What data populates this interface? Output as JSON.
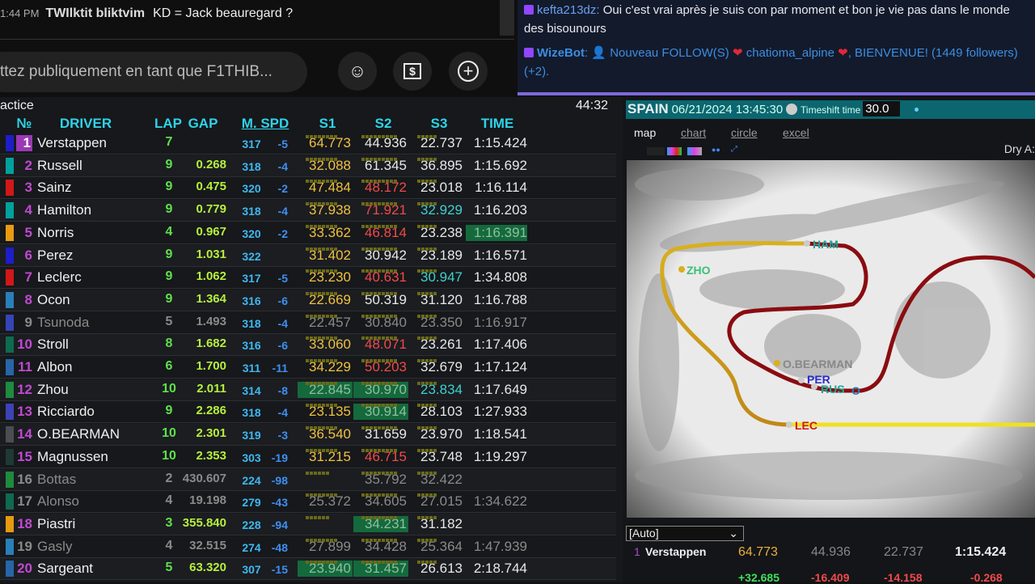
{
  "yt_chat": {
    "time": "1:44 PM",
    "author": "TWIlktit bliktvim",
    "message": "KD = Jack beauregard ?",
    "input_placeholder": "ttez publiquement en tant que F1THIB...",
    "emoji_icon": "emoji-icon",
    "super_chat_icon": "dollar-icon",
    "add_icon": "plus-icon"
  },
  "twitch_chat": [
    {
      "user": "kefta213dz",
      "message": "Oui c'est vrai après je suis con par moment et bon je vie pas dans le monde des bisounours"
    },
    {
      "user": "WizeBot",
      "message_pre": "👤 Nouveau FOLLOW(S) ",
      "heart": "❤",
      "follower": "chatioma_alpine",
      "message_post": ", BIENVENUE! (1449 followers) (+2)."
    }
  ],
  "timing": {
    "session": "actice",
    "clock": "44:32",
    "headers": {
      "no": "№",
      "driver": "DRIVER",
      "lap": "LAP",
      "gap": "GAP",
      "mspd": "M. SPD",
      "s1": "S1",
      "s2": "S2",
      "s3": "S3",
      "time": "TIME"
    },
    "rows": [
      {
        "pos": "1",
        "name": "Verstappen",
        "team": "#1e1ec8",
        "lap": "7",
        "gap": "",
        "spd": "317",
        "dspd": "-5",
        "s1": [
          "64.773",
          "y"
        ],
        "s2": [
          "44.936",
          "w"
        ],
        "s3": [
          "22.737",
          "w"
        ],
        "time": [
          "1:15.424",
          "w"
        ]
      },
      {
        "pos": "2",
        "name": "Russell",
        "team": "#00a19c",
        "lap": "9",
        "gap": "0.268",
        "spd": "318",
        "dspd": "-4",
        "s1": [
          "32.088",
          "y"
        ],
        "s2": [
          "61.345",
          "w"
        ],
        "s3": [
          "36.895",
          "w"
        ],
        "time": [
          "1:15.692",
          "w"
        ]
      },
      {
        "pos": "3",
        "name": "Sainz",
        "team": "#d01818",
        "lap": "9",
        "gap": "0.475",
        "spd": "320",
        "dspd": "-2",
        "s1": [
          "47.484",
          "y"
        ],
        "s2": [
          "48.172",
          "r"
        ],
        "s3": [
          "23.018",
          "w"
        ],
        "time": [
          "1:16.114",
          "w"
        ]
      },
      {
        "pos": "4",
        "name": "Hamilton",
        "team": "#00a19c",
        "lap": "9",
        "gap": "0.779",
        "spd": "318",
        "dspd": "-4",
        "s1": [
          "37.938",
          "y"
        ],
        "s2": [
          "71.921",
          "r"
        ],
        "s3": [
          "32.929",
          "c"
        ],
        "time": [
          "1:16.203",
          "w"
        ]
      },
      {
        "pos": "5",
        "name": "Norris",
        "team": "#e89a10",
        "lap": "4",
        "gap": "0.967",
        "spd": "320",
        "dspd": "-2",
        "s1": [
          "33.362",
          "y"
        ],
        "s2": [
          "46.814",
          "r"
        ],
        "s3": [
          "23.238",
          "w"
        ],
        "time": [
          "1:16.391",
          "tg"
        ]
      },
      {
        "pos": "6",
        "name": "Perez",
        "team": "#1e1ec8",
        "lap": "9",
        "gap": "1.031",
        "spd": "322",
        "dspd": "",
        "s1": [
          "31.402",
          "y"
        ],
        "s2": [
          "30.942",
          "w"
        ],
        "s3": [
          "23.189",
          "w"
        ],
        "time": [
          "1:16.571",
          "w"
        ]
      },
      {
        "pos": "7",
        "name": "Leclerc",
        "team": "#d01818",
        "lap": "9",
        "gap": "1.062",
        "spd": "317",
        "dspd": "-5",
        "s1": [
          "23.230",
          "y"
        ],
        "s2": [
          "40.631",
          "r"
        ],
        "s3": [
          "30.947",
          "c"
        ],
        "time": [
          "1:34.808",
          "w"
        ]
      },
      {
        "pos": "8",
        "name": "Ocon",
        "team": "#2a7fb8",
        "lap": "9",
        "gap": "1.364",
        "spd": "316",
        "dspd": "-6",
        "s1": [
          "22.669",
          "y"
        ],
        "s2": [
          "50.319",
          "w"
        ],
        "s3": [
          "31.120",
          "w"
        ],
        "time": [
          "1:16.788",
          "w"
        ]
      },
      {
        "pos": "9",
        "name": "Tsunoda",
        "team": "#3545b5",
        "dim": true,
        "lap": "5",
        "gap": "1.493",
        "spd": "318",
        "dspd": "-4",
        "s1": [
          "22.457",
          "d"
        ],
        "s2": [
          "30.840",
          "d"
        ],
        "s3": [
          "23.350",
          "d"
        ],
        "time": [
          "1:16.917",
          "d"
        ]
      },
      {
        "pos": "10",
        "name": "Stroll",
        "team": "#0f6b4e",
        "lap": "8",
        "gap": "1.682",
        "spd": "316",
        "dspd": "-6",
        "s1": [
          "33.060",
          "y"
        ],
        "s2": [
          "48.071",
          "r"
        ],
        "s3": [
          "23.261",
          "w"
        ],
        "time": [
          "1:17.406",
          "w"
        ]
      },
      {
        "pos": "11",
        "name": "Albon",
        "team": "#2765a8",
        "lap": "6",
        "gap": "1.700",
        "spd": "311",
        "dspd": "-11",
        "s1": [
          "34.229",
          "y"
        ],
        "s2": [
          "50.203",
          "r"
        ],
        "s3": [
          "32.679",
          "w"
        ],
        "time": [
          "1:17.124",
          "w"
        ]
      },
      {
        "pos": "12",
        "name": "Zhou",
        "team": "#1e8b3e",
        "lap": "10",
        "gap": "2.011",
        "spd": "314",
        "dspd": "-8",
        "s1": [
          "22.845",
          "g"
        ],
        "s2": [
          "30.970",
          "g"
        ],
        "s3": [
          "23.834",
          "c"
        ],
        "time": [
          "1:17.649",
          "w"
        ]
      },
      {
        "pos": "13",
        "name": "Ricciardo",
        "team": "#3d43b5",
        "lap": "9",
        "gap": "2.286",
        "spd": "318",
        "dspd": "-4",
        "s1": [
          "23.135",
          "y"
        ],
        "s2": [
          "30.914",
          "g"
        ],
        "s3": [
          "28.103",
          "w"
        ],
        "time": [
          "1:27.933",
          "w"
        ]
      },
      {
        "pos": "14",
        "name": "O.BEARMAN",
        "team": "#4a4d52",
        "lap": "10",
        "gap": "2.301",
        "spd": "319",
        "dspd": "-3",
        "s1": [
          "36.540",
          "y"
        ],
        "s2": [
          "31.659",
          "w"
        ],
        "s3": [
          "23.970",
          "w"
        ],
        "time": [
          "1:18.541",
          "w"
        ]
      },
      {
        "pos": "15",
        "name": "Magnussen",
        "team": "#1e3a32",
        "lap": "10",
        "gap": "2.353",
        "spd": "303",
        "dspd": "-19",
        "s1": [
          "31.215",
          "y"
        ],
        "s2": [
          "46.715",
          "r"
        ],
        "s3": [
          "23.748",
          "w"
        ],
        "time": [
          "1:19.297",
          "w"
        ]
      },
      {
        "pos": "16",
        "name": "Bottas",
        "team": "#1e8b3e",
        "dim": true,
        "lap": "2",
        "gap": "430.607",
        "spd": "224",
        "dspd": "-98",
        "s1": [
          "",
          "d"
        ],
        "s2": [
          "35.792",
          "d"
        ],
        "s3": [
          "32.422",
          "d"
        ],
        "time": [
          "",
          "d"
        ]
      },
      {
        "pos": "17",
        "name": "Alonso",
        "team": "#0f6b4e",
        "dim": true,
        "lap": "4",
        "gap": "19.198",
        "spd": "279",
        "dspd": "-43",
        "s1": [
          "25.372",
          "d"
        ],
        "s2": [
          "34.605",
          "d"
        ],
        "s3": [
          "27.015",
          "d"
        ],
        "time": [
          "1:34.622",
          "d"
        ]
      },
      {
        "pos": "18",
        "name": "Piastri",
        "team": "#e89a10",
        "lap": "3",
        "gap": "355.840",
        "spd": "228",
        "dspd": "-94",
        "s1": [
          "",
          "d"
        ],
        "s2": [
          "34.231",
          "g"
        ],
        "s3": [
          "31.182",
          "w"
        ],
        "time": [
          "",
          "w"
        ]
      },
      {
        "pos": "19",
        "name": "Gasly",
        "team": "#2a7fb8",
        "dim": true,
        "lap": "4",
        "gap": "32.515",
        "spd": "274",
        "dspd": "-48",
        "s1": [
          "27.899",
          "d"
        ],
        "s2": [
          "34.428",
          "d"
        ],
        "s3": [
          "25.364",
          "d"
        ],
        "time": [
          "1:47.939",
          "d"
        ]
      },
      {
        "pos": "20",
        "name": "Sargeant",
        "team": "#2765a8",
        "lap": "5",
        "gap": "63.320",
        "spd": "307",
        "dspd": "-15",
        "s1": [
          "23.940",
          "g"
        ],
        "s2": [
          "31.457",
          "g"
        ],
        "s3": [
          "26.613",
          "w"
        ],
        "time": [
          "2:18.744",
          "w"
        ]
      }
    ]
  },
  "tracker": {
    "country": "SPAIN",
    "datetime": "06/21/2024 13:45:30",
    "timeshift_label": "Timeshift time",
    "timeshift_value": "30.0",
    "tabs": [
      {
        "label": "map",
        "active": true
      },
      {
        "label": "chart"
      },
      {
        "label": "circle"
      },
      {
        "label": "excel"
      }
    ],
    "weather": "Dry A:",
    "map_labels": {
      "ham": "HAM",
      "zho": "ZHO",
      "bea": "O.BEARMAN",
      "per": "PER",
      "rus": "RUS",
      "oco": "O",
      "lec": "LEC"
    },
    "select_value": "[Auto]",
    "selected": {
      "pos": "1",
      "name": "Verstappen",
      "s1": "64.773",
      "s2": "44.936",
      "s3": "22.737",
      "time": "1:15.424"
    },
    "deltas": {
      "s1": "+32.685",
      "s2": "-16.409",
      "s3": "-14.158",
      "time": "-0.268"
    }
  },
  "colors": {
    "accent": "#2fd3e8",
    "teal_bar": "#0c6670",
    "twitch_purple": "#7a6ad8"
  }
}
